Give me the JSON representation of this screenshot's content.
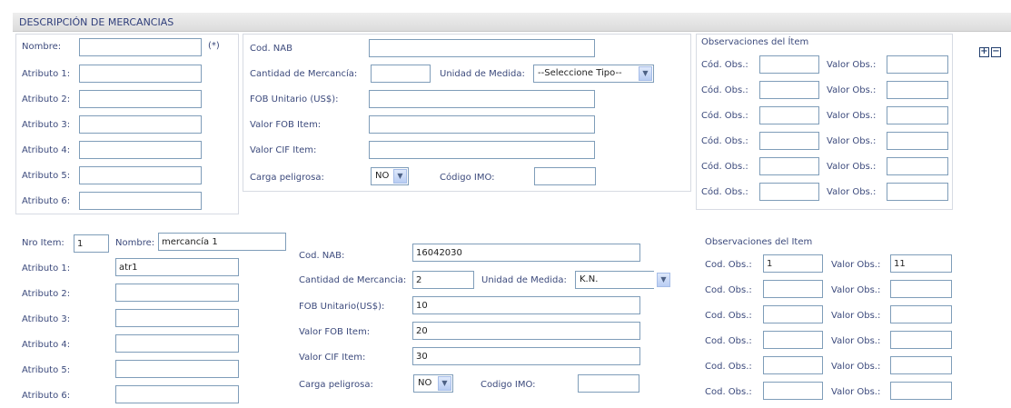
{
  "header": {
    "title": "DESCRIPCIÓN DE MERCANCIAS"
  },
  "form1": {
    "nombre_label": "Nombre:",
    "required_mark": "(*)",
    "atributos": [
      "Atributo 1:",
      "Atributo 2:",
      "Atributo 3:",
      "Atributo 4:",
      "Atributo 5:",
      "Atributo 6:"
    ],
    "cod_nab_label": "Cod. NAB",
    "cantidad_label": "Cantidad de Mercancía:",
    "unidad_label": "Unidad de Medida:",
    "unidad_value": "--Seleccione Tipo--",
    "fob_unit_label": "FOB Unitario (US$):",
    "fob_item_label": "Valor FOB Item:",
    "cif_item_label": "Valor CIF Item:",
    "carga_label": "Carga peligrosa:",
    "carga_value": "NO",
    "imo_label": "Código IMO:",
    "obs_title": "Observaciones del Ítem",
    "cod_obs_label": "Cód. Obs.:",
    "valor_obs_label": "Valor Obs.:",
    "add_icon": "plus-icon",
    "remove_icon": "minus-icon"
  },
  "form2": {
    "nro_item_label": "Nro Item:",
    "nro_item_value": "1",
    "nombre_label": "Nombre:",
    "nombre_value": "mercancía 1",
    "atributos": [
      "Atributo 1:",
      "Atributo 2:",
      "Atributo 3:",
      "Atributo 4:",
      "Atributo 5:",
      "Atributo 6:"
    ],
    "atributo_values": [
      "atr1",
      "",
      "",
      "",
      "",
      ""
    ],
    "cod_nab_label": "Cod. NAB:",
    "cod_nab_value": "16042030",
    "cantidad_label": "Cantidad de Mercancia:",
    "cantidad_value": "2",
    "unidad_label": "Unidad de Medida:",
    "unidad_value": "K.N.",
    "fob_unit_label": "FOB Unitario(US$):",
    "fob_unit_value": "10",
    "fob_item_label": "Valor FOB Item:",
    "fob_item_value": "20",
    "cif_item_label": "Valor CIF Item:",
    "cif_item_value": "30",
    "carga_label": "Carga peligrosa:",
    "carga_value": "NO",
    "imo_label": "Codigo IMO:",
    "obs_title": "Observaciones del Item",
    "cod_obs_label": "Cod. Obs.:",
    "valor_obs_label": "Valor Obs.:",
    "cod_obs_values": [
      "1",
      "",
      "",
      "",
      "",
      ""
    ],
    "valor_obs_values": [
      "11",
      "",
      "",
      "",
      "",
      ""
    ]
  }
}
